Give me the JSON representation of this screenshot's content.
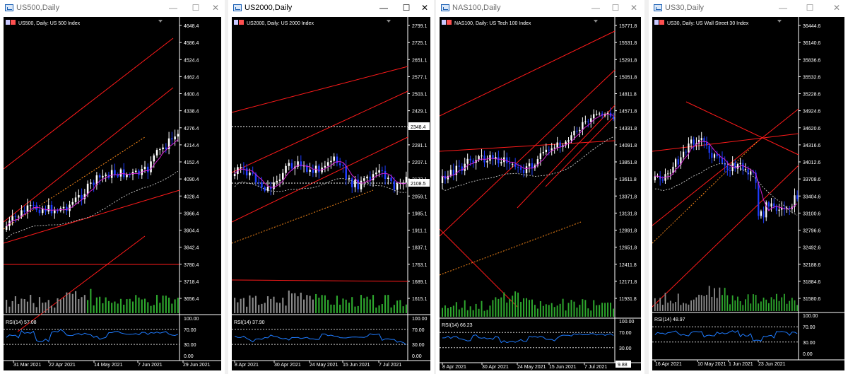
{
  "windows": [
    {
      "title": "US500,Daily",
      "header": "US500, Daily:  US 500 Index",
      "prices": [
        "4648.4",
        "4586.4",
        "4524.4",
        "4462.4",
        "4400.4",
        "4338.4",
        "4276.4",
        "4214.4",
        "4152.4",
        "4090.4",
        "4028.4",
        "3966.4",
        "3904.4",
        "3842.4",
        "3780.4",
        "3718.4",
        "3656.4"
      ],
      "price_marker": "",
      "price_marker2": "",
      "rsi_label": "RSI(14) 57.08",
      "rsi_levels": [
        "100.00",
        "70.00",
        "30.00",
        "0.00"
      ],
      "rsi_marker": "",
      "dates": [
        "31 Mar 2021",
        "22 Apr 2021",
        "14 May 2021",
        "7 Jun 2021",
        "29 Jun 2021"
      ]
    },
    {
      "title": "US2000,Daily",
      "header": "US2000, Daily:  US 2000 Index",
      "prices": [
        "2799.1",
        "2725.1",
        "2651.1",
        "2577.1",
        "2503.1",
        "2429.1",
        "2355.1",
        "2281.1",
        "2207.1",
        "2133.1",
        "2059.1",
        "1985.1",
        "1911.1",
        "1837.1",
        "1763.1",
        "1689.1",
        "1615.1"
      ],
      "price_marker": "2348.4",
      "price_marker2": "2108.5",
      "rsi_label": "RSI(14) 37.90",
      "rsi_levels": [
        "100.00",
        "70.00",
        "30.00",
        "0.00"
      ],
      "rsi_marker": "",
      "dates": [
        "8 Apr 2021",
        "30 Apr 2021",
        "24 May 2021",
        "15 Jun 2021",
        "7 Jul 2021"
      ]
    },
    {
      "title": "NAS100,Daily",
      "header": "NAS100, Daily:  US Tech 100 Index",
      "prices": [
        "15771.8",
        "15531.8",
        "15291.8",
        "15051.8",
        "14811.8",
        "14571.8",
        "14331.8",
        "14091.8",
        "13851.8",
        "13611.8",
        "13371.8",
        "13131.8",
        "12891.8",
        "12651.8",
        "12411.8",
        "12171.8",
        "11931.8"
      ],
      "price_marker": "",
      "price_marker2": "",
      "rsi_label": "RSI(14) 66.23",
      "rsi_levels": [
        "100.00",
        "70.00",
        "30.00"
      ],
      "rsi_marker": "9.88",
      "dates": [
        "8 Apr 2021",
        "30 Apr 2021",
        "24 May 2021",
        "15 Jun 2021",
        "7 Jul 2021"
      ]
    },
    {
      "title": "US30,Daily",
      "header": "US30, Daily:  US Wall Street 30 Index",
      "prices": [
        "36444.6",
        "36140.6",
        "35836.6",
        "35532.6",
        "35228.6",
        "34924.6",
        "34620.6",
        "34316.6",
        "34012.6",
        "33708.6",
        "33404.6",
        "33100.6",
        "32796.6",
        "32492.6",
        "32188.6",
        "31884.6",
        "31580.6"
      ],
      "price_marker": "",
      "price_marker2": "",
      "rsi_label": "RSI(14) 48.97",
      "rsi_levels": [
        "100.00",
        "70.00",
        "30.00",
        "0.00"
      ],
      "rsi_marker": "",
      "dates": [
        "16 Apr 2021",
        "10 May 2021",
        "1 Jun 2021",
        "23 Jun 2021"
      ]
    }
  ],
  "controls": {
    "minimize": "—",
    "maximize": "☐",
    "close": "✕"
  },
  "colors": {
    "background": "#000000",
    "bull": "#ffffff",
    "bear": "#1e3cff",
    "trendline": "#ff1a1a",
    "ma": "#ff3333",
    "rsi": "#1e7bff",
    "volume_up": "#2ea82e",
    "volume_down": "#8a8a8a"
  }
}
